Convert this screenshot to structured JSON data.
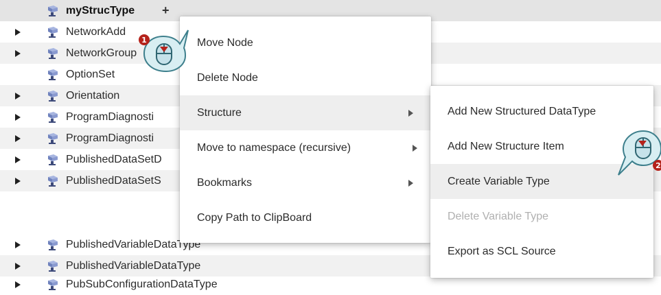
{
  "tree": {
    "rows": [
      {
        "label": "myStrucType",
        "expander": false,
        "selected": true,
        "plus": "+"
      },
      {
        "label": "NetworkAdd",
        "expander": true
      },
      {
        "label": "NetworkGroup",
        "expander": true
      },
      {
        "label": "OptionSet",
        "expander": false
      },
      {
        "label": "Orientation",
        "expander": true
      },
      {
        "label": "ProgramDiagnosti",
        "expander": true
      },
      {
        "label": "ProgramDiagnosti",
        "expander": true
      },
      {
        "label": "PublishedDataSetD",
        "expander": true
      },
      {
        "label": "PublishedDataSetS",
        "expander": true
      },
      {
        "label": "PublishedVariableDataType",
        "expander": true
      },
      {
        "label": "PubSubConfigurationDataType",
        "expander": true
      }
    ]
  },
  "context_menu": {
    "items": [
      {
        "label": "Move Node"
      },
      {
        "label": "Delete Node"
      },
      {
        "label": "Structure",
        "submenu": true,
        "highlighted": true
      },
      {
        "label": "Move to namespace (recursive)",
        "submenu": true
      },
      {
        "label": "Bookmarks",
        "submenu": true
      },
      {
        "label": "Copy Path to ClipBoard"
      }
    ]
  },
  "submenu": {
    "items": [
      {
        "label": "Add New Structured DataType"
      },
      {
        "label": "Add New Structure Item"
      },
      {
        "label": "Create Variable Type",
        "highlighted": true
      },
      {
        "label": "Delete Variable Type",
        "disabled": true
      },
      {
        "label": "Export as SCL Source"
      }
    ]
  },
  "callouts": [
    {
      "step": "1"
    },
    {
      "step": "2"
    }
  ],
  "colors": {
    "node_icon_body": "#7d8fc4",
    "node_icon_base": "#3d4a7a",
    "callout_fill": "#d8eef2",
    "callout_stroke": "#3d7f8c",
    "badge": "#b5221b"
  }
}
